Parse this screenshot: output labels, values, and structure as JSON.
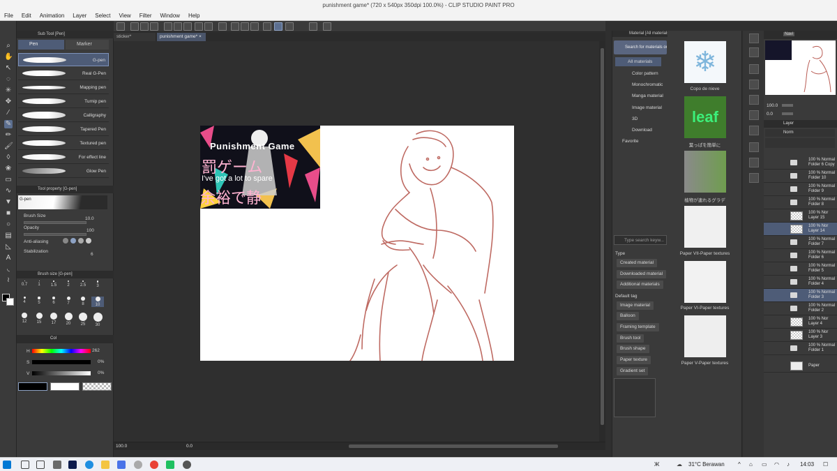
{
  "window": {
    "title": "punishment game* (720 x 540px 350dpi 100.0%) - CLIP STUDIO PAINT PRO"
  },
  "menu": [
    "File",
    "Edit",
    "Animation",
    "Layer",
    "Select",
    "View",
    "Filter",
    "Window",
    "Help"
  ],
  "tabs": [
    {
      "label": "sticker*"
    },
    {
      "label": "punishment game*"
    }
  ],
  "subtool": {
    "panel_title": "Sub Tool [Pen]",
    "tab_pen": "Pen",
    "tab_marker": "Marker",
    "brushes": [
      "G-pen",
      "Real G-Pen",
      "Mapping pen",
      "Turnip pen",
      "Calligraphy",
      "Tapered Pen",
      "Textured pen",
      "For effect line",
      "Glow Pen"
    ]
  },
  "toolprop": {
    "panel_title": "Tool property [G-pen]",
    "preview_label": "G-pen",
    "brush_size_label": "Brush Size",
    "brush_size_value": "10.0",
    "opacity_label": "Opacity",
    "opacity_value": "100",
    "aa_label": "Anti-aliasing",
    "stab_label": "Stabilization",
    "stab_value": "6"
  },
  "brushsize": {
    "panel_title": "Brush size [G-pen]",
    "sizes": [
      "0.7",
      "1",
      "1.5",
      "2",
      "2.5",
      "3",
      "4",
      "5",
      "6",
      "7",
      "8",
      "10",
      "12",
      "15",
      "17",
      "20",
      "25",
      "30"
    ]
  },
  "color": {
    "tab_label": "Col",
    "h_label": "H",
    "h_value": "262",
    "s_label": "S",
    "s_value": "0%",
    "v_label": "V",
    "v_value": "0%"
  },
  "artwork": {
    "title_en": "Punishment Game",
    "title_jp": "罰ゲーム",
    "line_en": "I've got a lot to spare",
    "line_jp": "余裕で静",
    "stroke_color": "#b85a52"
  },
  "status": {
    "zoom": "100.0",
    "rotate": "0.0"
  },
  "material": {
    "panel_title": "Material [All materials]",
    "search_button": "Search for materials on ASSETS",
    "tree": [
      "All materials",
      "Color pattern",
      "Monochromatic",
      "Manga material",
      "Image material",
      "3D",
      "Download",
      "Favorite"
    ],
    "search_placeholder": "Type search keyw...",
    "type_label": "Type",
    "type_chips": [
      "Created material",
      "Downloaded material",
      "Additional materials"
    ],
    "default_tag_label": "Default tag",
    "tag_chips": [
      "Image material",
      "Balloon",
      "Framing template",
      "Brush tool",
      "Brush shape",
      "Paper texture",
      "Gradient set"
    ],
    "items": [
      "Copo de nieve",
      "葉っぱを簡単に",
      "植物が連れるグラデ",
      "Paper VII-Paper textures",
      "Paper VI-Paper textures",
      "Paper V-Paper textures"
    ]
  },
  "navigator": {
    "tab_label": "Navi",
    "zoom": "100.0",
    "rotate": "0.0"
  },
  "layer": {
    "tab_label": "Layer",
    "blend": "Norm",
    "rows": [
      {
        "pct": "100 %",
        "mode": "Normal",
        "name": "Folder 6 Copy"
      },
      {
        "pct": "100 %",
        "mode": "Normal",
        "name": "Folder 10"
      },
      {
        "pct": "100 %",
        "mode": "Normal",
        "name": "Folder 9"
      },
      {
        "pct": "100 %",
        "mode": "Normal",
        "name": "Folder 8"
      },
      {
        "pct": "100 %",
        "mode": "Nor",
        "name": "Layer 15"
      },
      {
        "pct": "100 %",
        "mode": "Nor",
        "name": "Layer 14"
      },
      {
        "pct": "100 %",
        "mode": "Normal",
        "name": "Folder 7"
      },
      {
        "pct": "100 %",
        "mode": "Normal",
        "name": "Folder 6"
      },
      {
        "pct": "100 %",
        "mode": "Normal",
        "name": "Folder 5"
      },
      {
        "pct": "100 %",
        "mode": "Normal",
        "name": "Folder 4"
      },
      {
        "pct": "100 %",
        "mode": "Normal",
        "name": "Folder 3"
      },
      {
        "pct": "100 %",
        "mode": "Normal",
        "name": "Folder 2"
      },
      {
        "pct": "100 %",
        "mode": "Nor",
        "name": "Layer 4"
      },
      {
        "pct": "100 %",
        "mode": "Nor",
        "name": "Layer 3"
      },
      {
        "pct": "100 %",
        "mode": "Normal",
        "name": "Folder 1"
      },
      {
        "pct": "",
        "mode": "",
        "name": "Paper"
      }
    ]
  },
  "taskbar": {
    "weather": "31°C  Berawan",
    "time": "14:03"
  }
}
